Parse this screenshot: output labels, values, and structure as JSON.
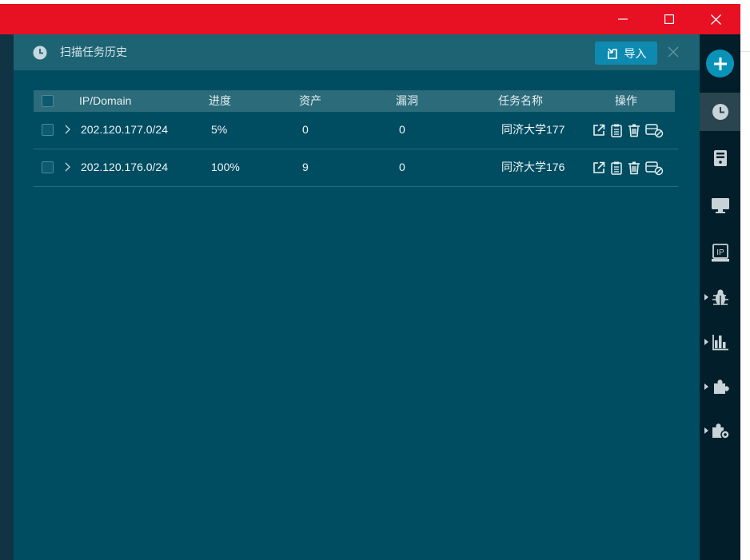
{
  "window": {
    "title_bar_color": "#e81123",
    "controls": [
      "minimize",
      "maximize",
      "close"
    ]
  },
  "panel": {
    "title": "扫描任务历史",
    "import_label": "导入"
  },
  "table": {
    "headers": {
      "ip": "IP/Domain",
      "progress": "进度",
      "assets": "资产",
      "vulns": "漏洞",
      "task_name": "任务名称",
      "actions": "操作"
    },
    "rows": [
      {
        "ip": "202.120.177.0/24",
        "progress": "5%",
        "assets": "0",
        "vulns": "0",
        "task_name": "同济大学177"
      },
      {
        "ip": "202.120.176.0/24",
        "progress": "100%",
        "assets": "9",
        "vulns": "0",
        "task_name": "同济大学176"
      }
    ],
    "row_actions": [
      "open-external-icon",
      "report-icon",
      "delete-icon",
      "disable-icon"
    ]
  },
  "sidebar": {
    "items": [
      "add-icon",
      "history-icon",
      "server-icon",
      "monitor-icon",
      "ip-icon",
      "bug-icon",
      "chart-icon",
      "plugin-icon",
      "plugin-settings-icon"
    ],
    "ip_icon_text": "IP",
    "active": "history-icon"
  },
  "colors": {
    "panel_bg": "#004d62",
    "panel_header": "#1e6374",
    "accent": "#0e8ab1",
    "sidebar_bg": "#011e2a"
  }
}
